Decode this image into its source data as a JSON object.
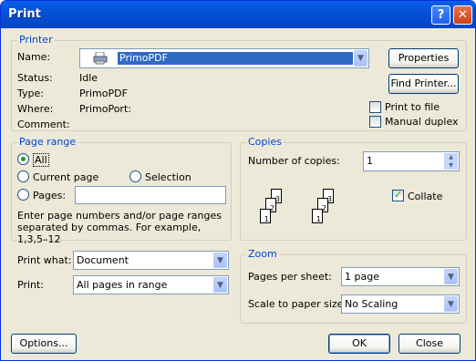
{
  "window": {
    "title": "Print",
    "help_glyph": "?",
    "close_glyph": "✕"
  },
  "printer": {
    "legend": "Printer",
    "name_label": "Name:",
    "name_value": "PrimoPDF",
    "status_label": "Status:",
    "status_value": "Idle",
    "type_label": "Type:",
    "type_value": "PrimoPDF",
    "where_label": "Where:",
    "where_value": "PrimoPort:",
    "comment_label": "Comment:",
    "comment_value": "",
    "properties_button": "Properties",
    "find_printer_button": "Find Printer...",
    "print_to_file_label": "Print to file",
    "manual_duplex_label": "Manual duplex",
    "print_to_file_checked": false,
    "manual_duplex_checked": false
  },
  "page_range": {
    "legend": "Page range",
    "all_label": "All",
    "current_page_label": "Current page",
    "selection_label": "Selection",
    "pages_label": "Pages:",
    "pages_value": "",
    "selected": "All",
    "hint": "Enter page numbers and/or page ranges separated by commas.  For example, 1,3,5–12"
  },
  "copies": {
    "legend": "Copies",
    "number_label": "Number of copies:",
    "number_value": "1",
    "collate_label": "Collate",
    "collate_checked": true,
    "page_numbers": [
      "1",
      "2",
      "3"
    ]
  },
  "print_what": {
    "label": "Print what:",
    "value": "Document"
  },
  "print": {
    "label": "Print:",
    "value": "All pages in range"
  },
  "zoom": {
    "legend": "Zoom",
    "pages_per_sheet_label": "Pages per sheet:",
    "pages_per_sheet_value": "1 page",
    "scale_label": "Scale to paper size:",
    "scale_value": "No Scaling"
  },
  "buttons": {
    "options": "Options...",
    "ok": "OK",
    "close": "Close"
  },
  "colors": {
    "title_bar": "#0550d6",
    "accent_legend": "#0046d5",
    "dialog_bg": "#ece9d8"
  },
  "icons": {
    "printer": "printer-icon",
    "dropdown": "chevron-down-icon",
    "spin_up": "arrow-up-icon",
    "spin_down": "arrow-down-icon"
  }
}
